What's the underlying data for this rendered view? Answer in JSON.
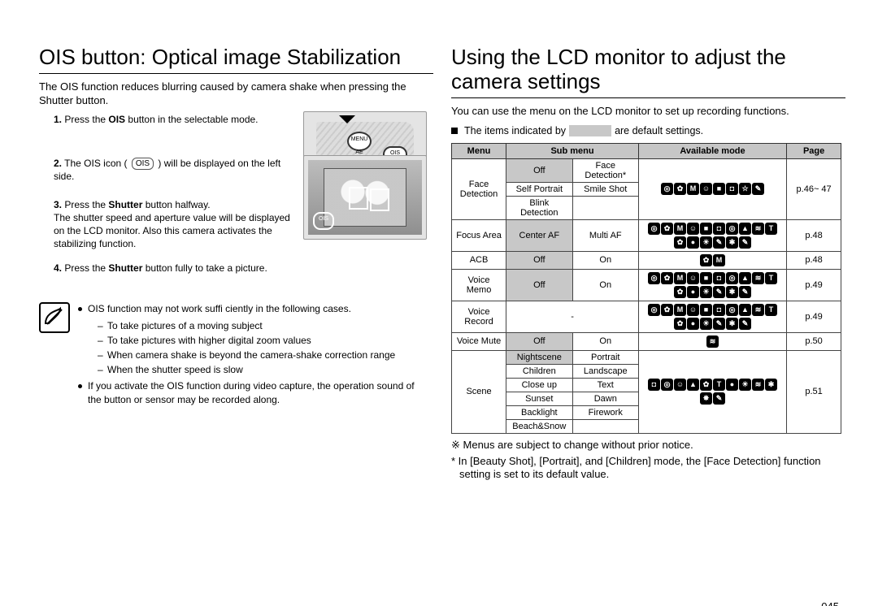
{
  "page_number": "045",
  "left": {
    "title": "OIS button: Optical image Stabilization",
    "intro": "The OIS function reduces blurring caused by camera shake when pressing the Shutter button.",
    "ois_icon_label": "OIS",
    "steps": [
      {
        "num": "1.",
        "text_before": "Press the ",
        "bold1": "OIS",
        "text_after": " button in the selectable mode."
      },
      {
        "num": "2.",
        "text_before": "The OIS icon ( ",
        "bold1": "",
        "text_after": " ) will be displayed on the left side."
      },
      {
        "num": "3.",
        "text_before": "Press the ",
        "bold1": "Shutter",
        "text_after": " button halfway."
      },
      {
        "num": "4.",
        "text_before": "Press the ",
        "bold1": "Shutter",
        "text_after": " button fully to take a picture."
      }
    ],
    "step3_extra": "The shutter speed and aperture value will be displayed on the LCD monitor. Also this camera activates the stabilizing function.",
    "camera_btn_ois": "OIS",
    "camera_btn_menu": "MENU AE",
    "notes": {
      "l1": "OIS function may not work suffi ciently in the following cases.",
      "s1": "To take pictures of a moving subject",
      "s2": "To take pictures with higher digital zoom values",
      "s3": "When camera shake is beyond the camera-shake correction range",
      "s4": "When the shutter speed is slow",
      "l2": "If you activate the OIS function during video capture, the operation sound of the button or sensor may be recorded along."
    }
  },
  "right": {
    "title": "Using the LCD monitor to adjust the camera settings",
    "intro": "You can use the menu on the LCD monitor to set up recording functions.",
    "default_note_pre": "The items indicated by",
    "default_note_post": "are default settings.",
    "table_headers": {
      "menu": "Menu",
      "sub": "Sub menu",
      "mode": "Available mode",
      "page": "Page"
    },
    "rows": {
      "face_detection": {
        "menu": "Face Detection",
        "subs": [
          "Off",
          "Face Detection*",
          "Self Portrait",
          "Smile Shot",
          "Blink Detection"
        ],
        "page": "p.46~ 47",
        "icons": [
          "◎",
          "✿",
          "M",
          "☺",
          "■",
          "◘",
          "☆",
          "✎"
        ]
      },
      "focus_area": {
        "menu": "Focus Area",
        "subs": [
          "Center AF",
          "Multi AF"
        ],
        "page": "p.48",
        "icons": [
          "◎",
          "✿",
          "M",
          "☺",
          "■",
          "◘",
          "◎",
          "▲",
          "≋",
          "T",
          "✿",
          "●",
          "☀",
          "✎",
          "✱",
          "✎"
        ]
      },
      "acb": {
        "menu": "ACB",
        "subs": [
          "Off",
          "On"
        ],
        "page": "p.48",
        "icons": [
          "✿",
          "M"
        ]
      },
      "voice_memo": {
        "menu": "Voice Memo",
        "subs": [
          "Off",
          "On"
        ],
        "page": "p.49",
        "icons": [
          "◎",
          "✿",
          "M",
          "☺",
          "■",
          "◘",
          "◎",
          "▲",
          "≋",
          "T",
          "✿",
          "●",
          "☀",
          "✎",
          "✱",
          "✎"
        ]
      },
      "voice_record": {
        "menu": "Voice Record",
        "sub": "-",
        "page": "p.49",
        "icons": [
          "◎",
          "✿",
          "M",
          "☺",
          "■",
          "◘",
          "◎",
          "▲",
          "≋",
          "T",
          "✿",
          "●",
          "☀",
          "✎",
          "✱",
          "✎"
        ]
      },
      "voice_mute": {
        "menu": "Voice Mute",
        "subs": [
          "Off",
          "On"
        ],
        "page": "p.50",
        "icons": [
          "≋"
        ]
      },
      "scene": {
        "menu": "Scene",
        "subs": [
          "Nightscene",
          "Portrait",
          "Children",
          "Landscape",
          "Close up",
          "Text",
          "Sunset",
          "Dawn",
          "Backlight",
          "Firework",
          "Beach&Snow"
        ],
        "page": "p.51",
        "icons": [
          "◘",
          "◎",
          "☺",
          "▲",
          "✿",
          "T",
          "●",
          "☀",
          "≋",
          "✱",
          "✸",
          "✎"
        ]
      }
    },
    "footnote1": "※ Menus are subject to change without prior notice.",
    "footnote2": "* In [Beauty Shot], [Portrait], and [Children] mode, the [Face Detection] function setting is set to its default value."
  }
}
